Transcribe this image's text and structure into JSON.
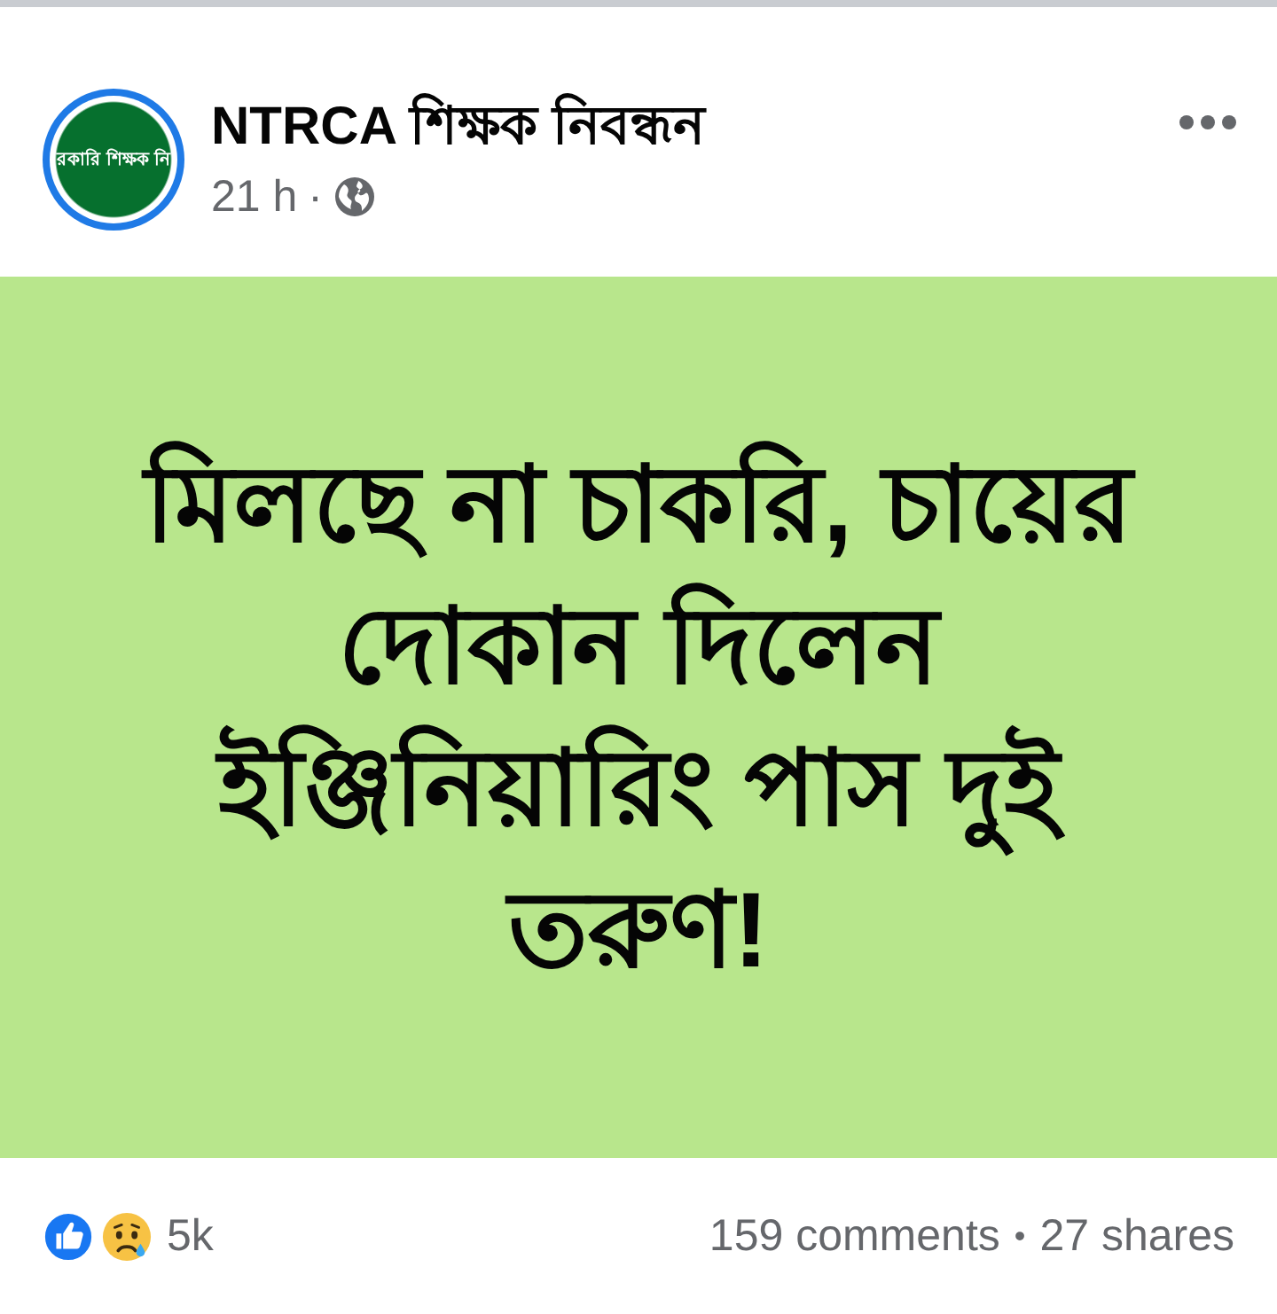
{
  "post": {
    "avatar": {
      "logo_text": "রকারি শিক্ষক নি"
    },
    "author": "NTRCA শিক্ষক নিবন্ধন",
    "time": "21 h",
    "separator": "·",
    "public": true
  },
  "card": {
    "text": "মিলছে না চাকরি, চায়ের দোকান দিলেন ইঞ্জিনিয়ারিং পাস দুই তরুণ!"
  },
  "footer": {
    "reactions": [
      {
        "kind": "like"
      },
      {
        "kind": "sad"
      }
    ],
    "reaction_count": "5k",
    "comments": "159 comments",
    "separator": "•",
    "shares": "27 shares"
  }
}
